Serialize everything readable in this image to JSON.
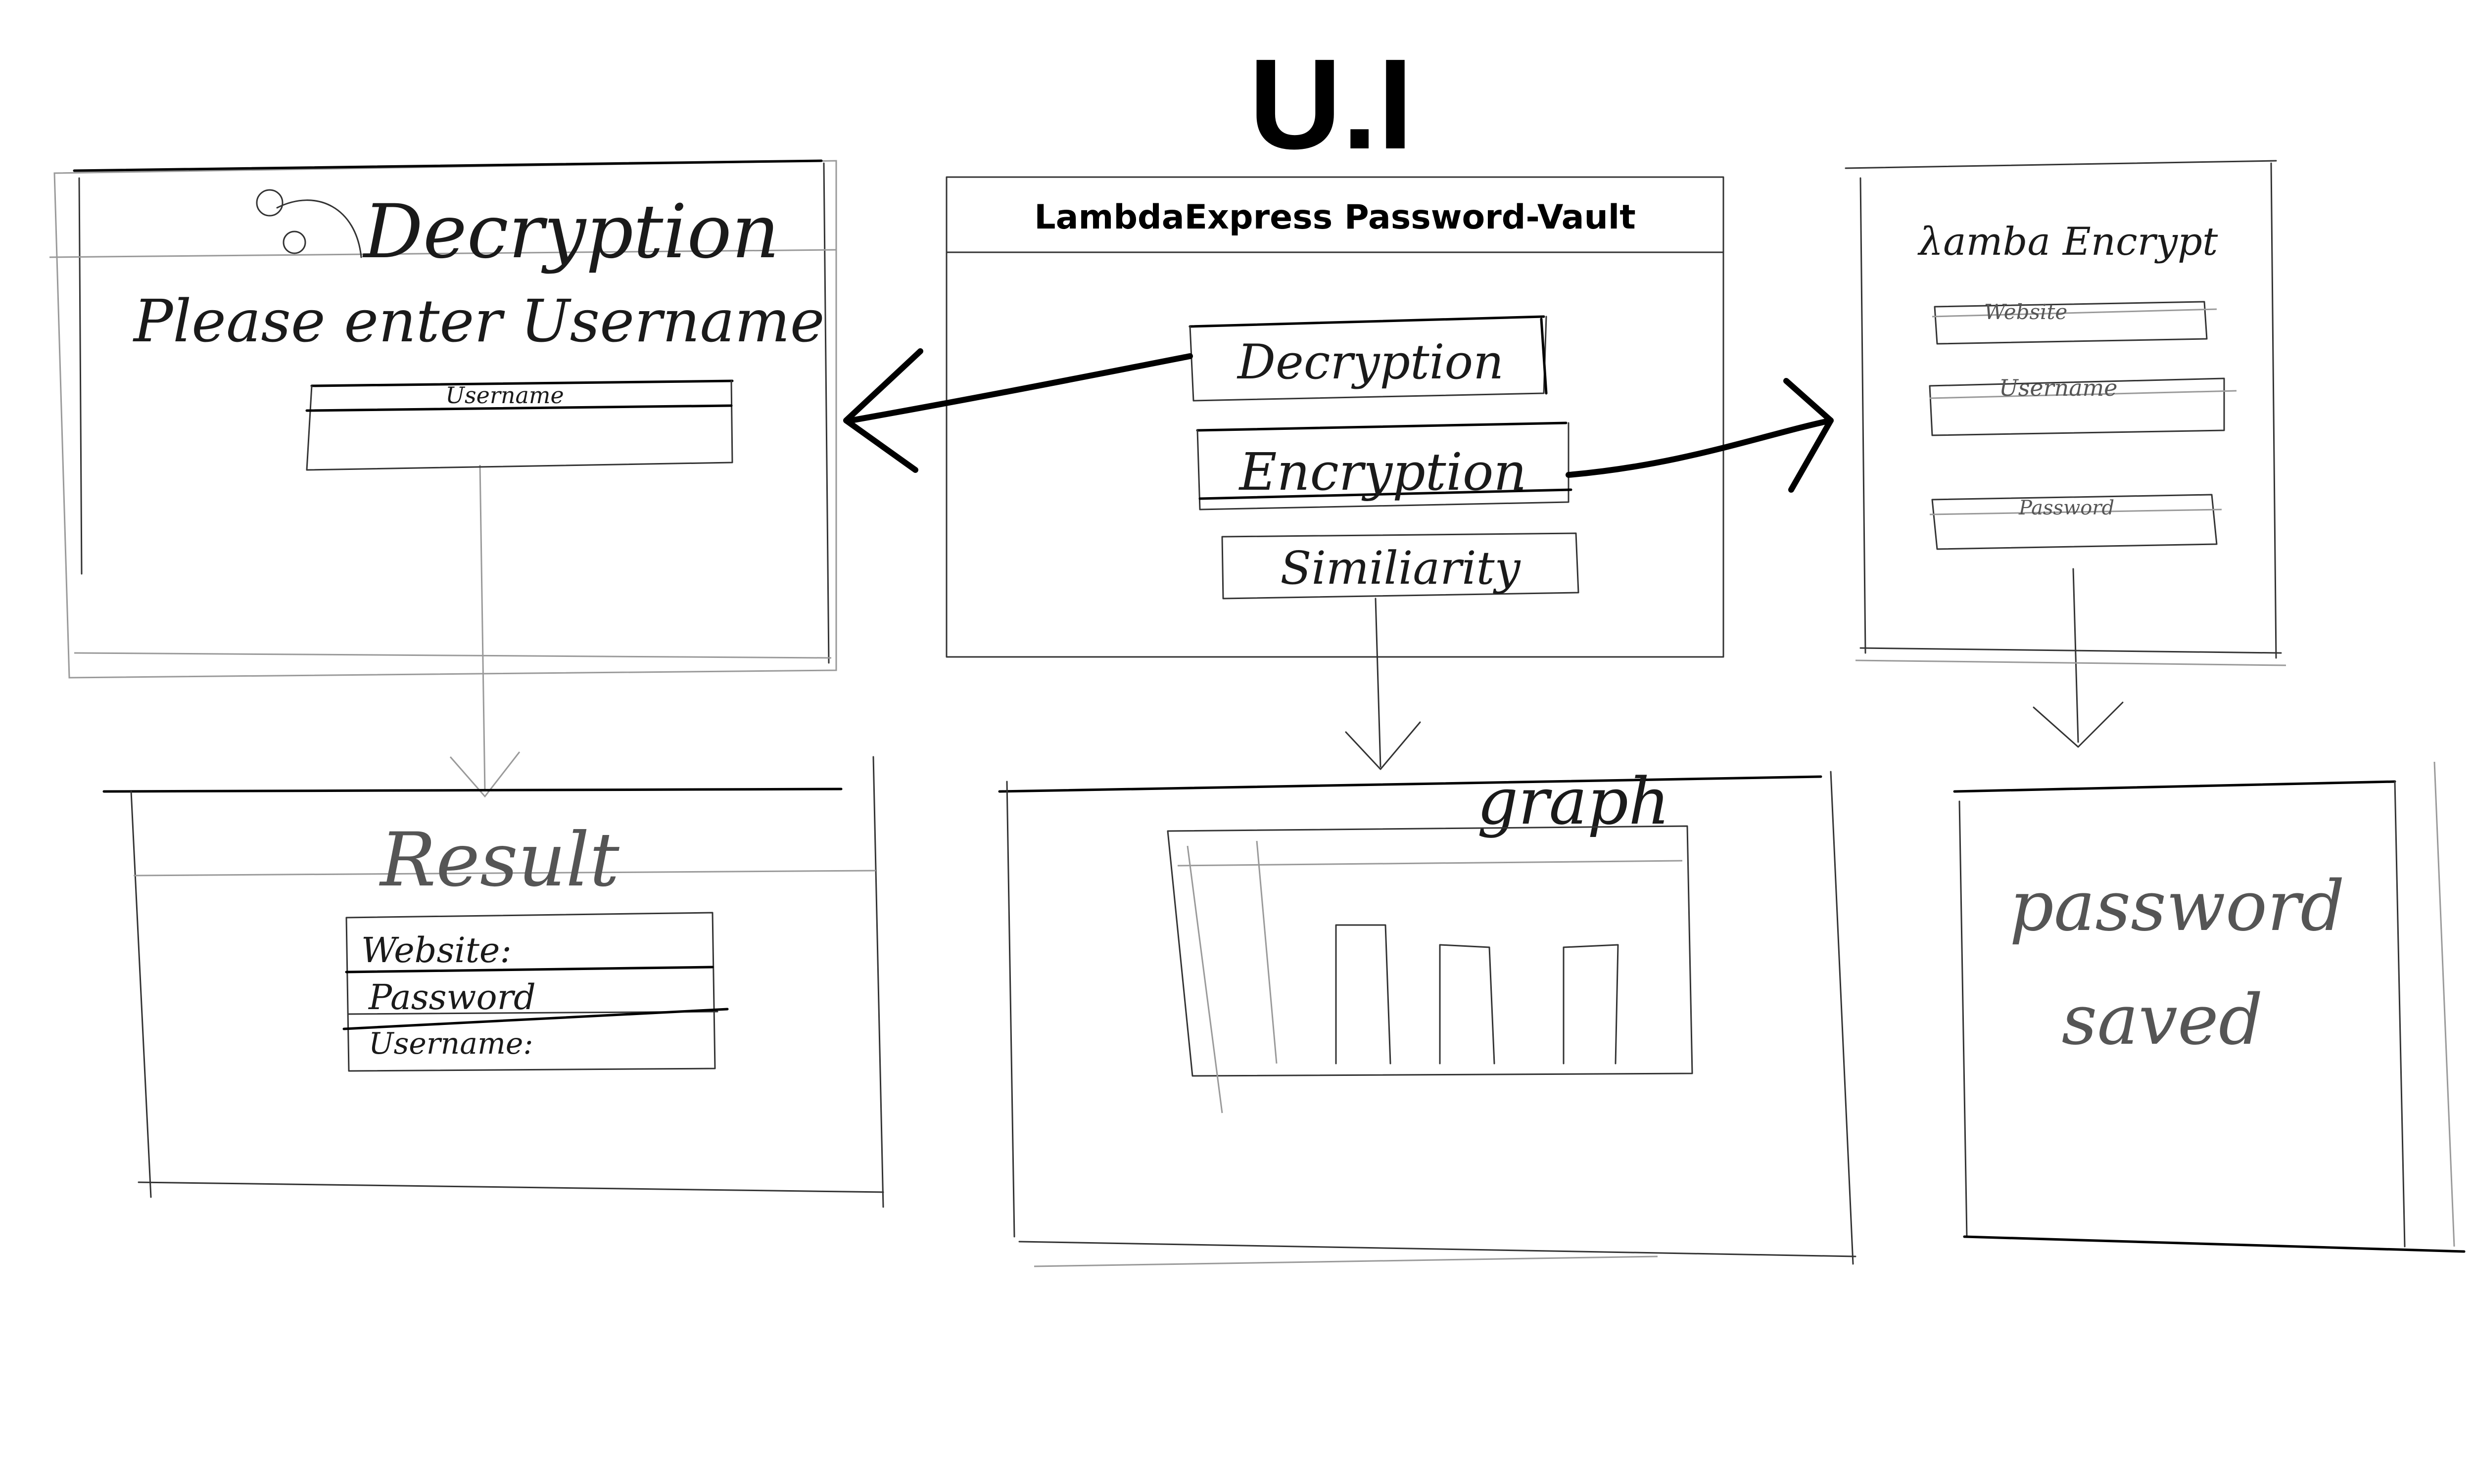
{
  "diagram_title": "U.I",
  "main_window": {
    "title": "LambdaExpress Password-Vault",
    "buttons": [
      "Decryption",
      "Encryption",
      "Similiarity"
    ]
  },
  "decryption_screen": {
    "title": "Decryption",
    "prompt": "Please enter Username",
    "input_label": "Username"
  },
  "result_screen": {
    "title": "Result",
    "fields": [
      "Website:",
      "Password",
      "Username:"
    ]
  },
  "graph_screen": {
    "title": "graph"
  },
  "encrypt_screen": {
    "title": "λamba Encrypt",
    "fields": [
      "Website",
      "Username",
      "Password"
    ]
  },
  "saved_screen": {
    "line1": "password",
    "line2": "saved"
  }
}
